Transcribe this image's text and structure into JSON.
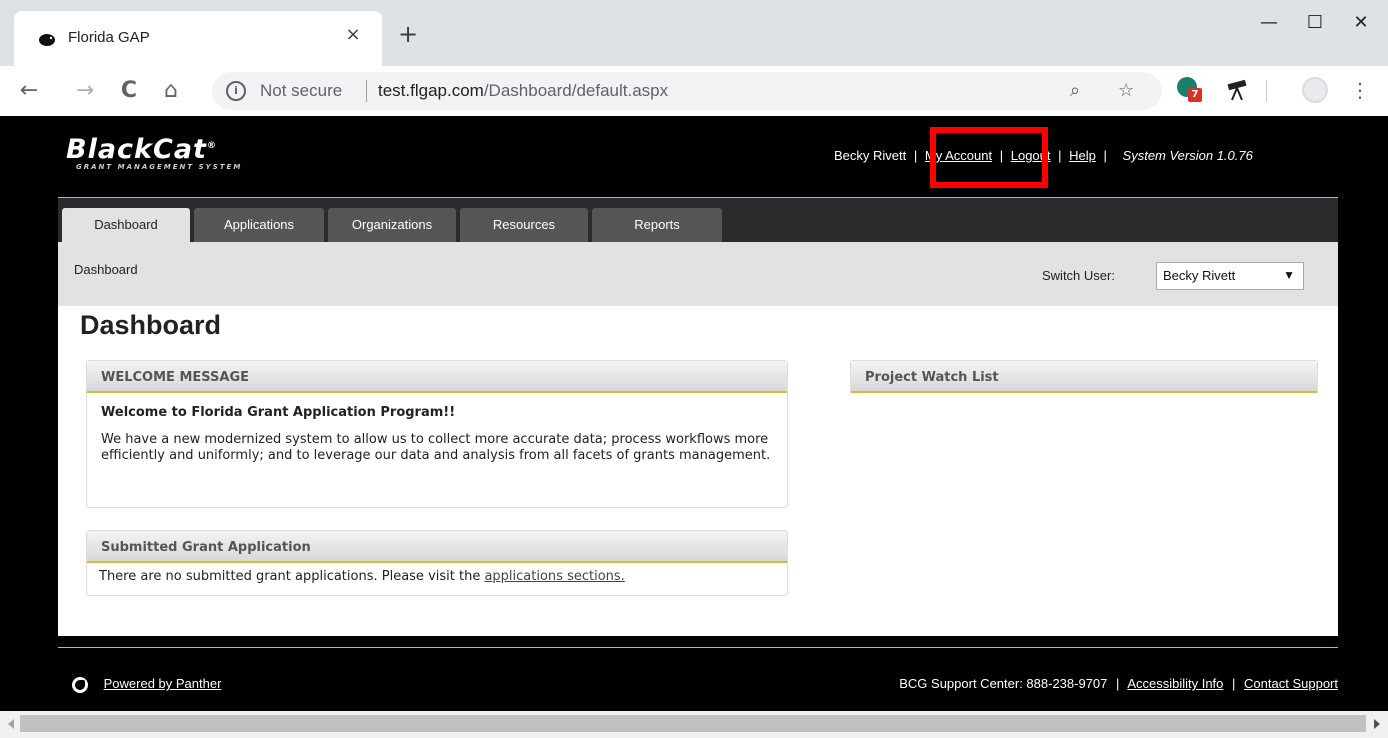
{
  "browser": {
    "tab_title": "Florida GAP",
    "tab_close": "×",
    "new_tab": "+",
    "minimize": "—",
    "maximize": "☐",
    "close": "✕",
    "back": "←",
    "forward": "→",
    "reload": "C",
    "home": "⌂",
    "info": "i",
    "not_secure": "Not secure",
    "url_host": "test.flgap.com",
    "url_path": "/Dashboard/default.aspx",
    "zoom": "⌕",
    "star": "☆",
    "ext_badge": "7",
    "menu": "⋮"
  },
  "header": {
    "logo": "BlackCat",
    "logo_reg": "®",
    "logo_sub": "GRANT MANAGEMENT SYSTEM",
    "user_name": "Becky Rivett",
    "sep": "|",
    "my_account": "My Account",
    "logout": "Logout",
    "help": "Help",
    "version": "System Version  1.0.76"
  },
  "nav": {
    "tabs": [
      {
        "label": "Dashboard",
        "active": true
      },
      {
        "label": "Applications"
      },
      {
        "label": "Organizations"
      },
      {
        "label": "Resources"
      },
      {
        "label": "Reports"
      }
    ]
  },
  "subbar": {
    "breadcrumb": "Dashboard",
    "switch_user_label": "Switch User:",
    "switch_user_value": "Becky Rivett",
    "arrow": "▼"
  },
  "main": {
    "title": "Dashboard",
    "welcome": {
      "header": "WELCOME MESSAGE",
      "title": "Welcome to Florida Grant Application Program!!",
      "text": "We have a new modernized system to allow us to collect more accurate data; process workflows more efficiently and uniformly; and to leverage our data and analysis from all facets of grants management."
    },
    "submitted": {
      "header": "Submitted Grant Application",
      "text": "There are no submitted grant applications. Please visit the ",
      "link": "applications sections."
    },
    "watch": {
      "header": "Project Watch List"
    }
  },
  "footer": {
    "powered_by": "Powered by Panther",
    "support": "BCG Support Center: 888-238-9707",
    "sep": "|",
    "accessibility": "Accessibility Info",
    "contact": "Contact Support"
  },
  "colors": {
    "accent_line": "#c9c33b",
    "highlight": "#ff0000",
    "page_bg": "#000000"
  }
}
